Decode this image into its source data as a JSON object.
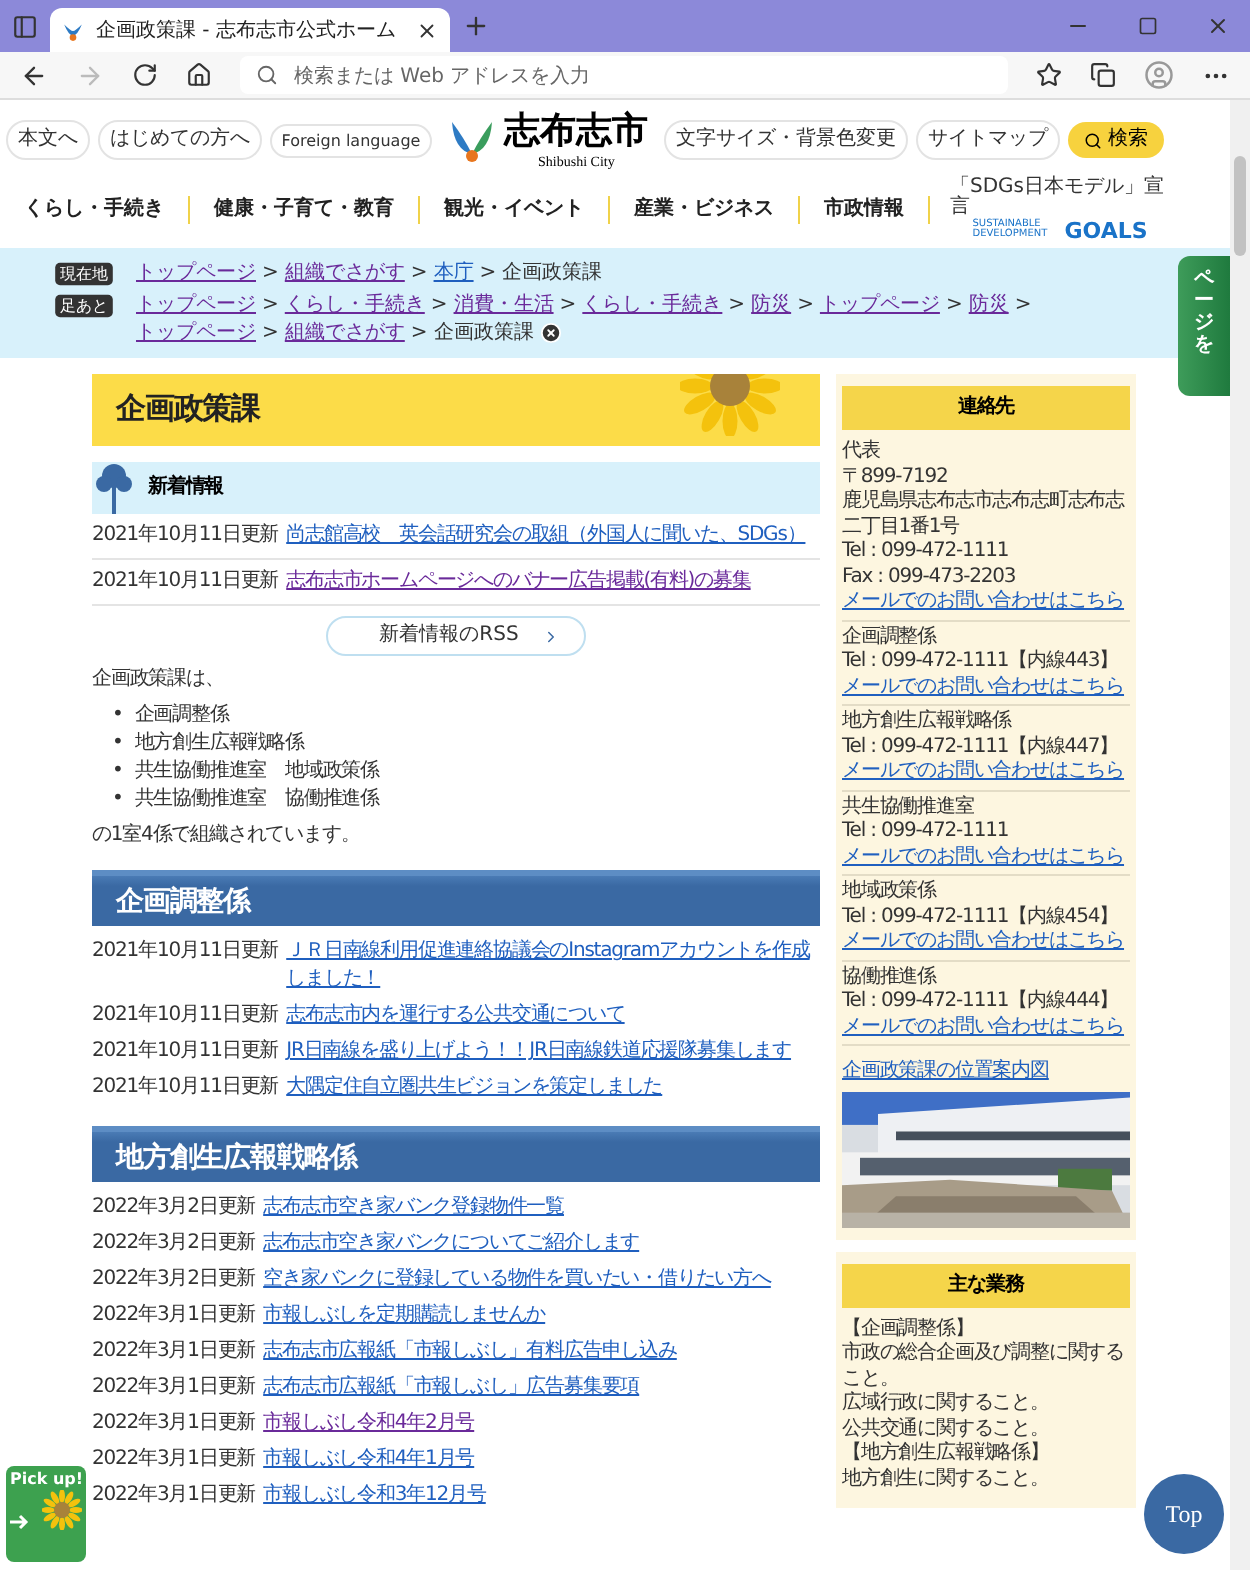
{
  "browser": {
    "tab_title": "企画政策課 - 志布志市公式ホーム",
    "address_placeholder": "検索または Web アドレスを入力"
  },
  "header": {
    "left_links": [
      "本文へ",
      "はじめての方へ",
      "Foreign language"
    ],
    "logo_title": "志布志市",
    "logo_subtitle": "Shibushi City",
    "right_links": [
      "文字サイズ・背景色変更",
      "サイトマップ"
    ],
    "search_button": "検索",
    "nav": [
      "くらし・手続き",
      "健康・子育て・教育",
      "観光・イベント",
      "産業・ビジネス",
      "市政情報"
    ],
    "sdgs": {
      "caption": "「SDGs日本モデル」宣言",
      "line1": "SUSTAINABLE DEVELOPMENT",
      "line2": "GOALS"
    }
  },
  "breadcrumb_separator": ">",
  "breadcrumbs": [
    {
      "badge": "現在地",
      "closable": false,
      "items": [
        {
          "label": "トップページ",
          "kind": "link",
          "visited": true
        },
        {
          "label": "組織でさがす",
          "kind": "link",
          "visited": true
        },
        {
          "label": "本庁",
          "kind": "link",
          "visited": false
        },
        {
          "label": "企画政策課",
          "kind": "current",
          "visited": false
        }
      ]
    },
    {
      "badge": "足あと",
      "closable": true,
      "items": [
        {
          "label": "トップページ",
          "kind": "link",
          "visited": true
        },
        {
          "label": "くらし・手続き",
          "kind": "link",
          "visited": true
        },
        {
          "label": "消費・生活",
          "kind": "link",
          "visited": true
        },
        {
          "label": "くらし・手続き",
          "kind": "link",
          "visited": true
        },
        {
          "label": "防災",
          "kind": "link",
          "visited": true
        },
        {
          "label": "トップページ",
          "kind": "link",
          "visited": true
        },
        {
          "label": "防災",
          "kind": "link",
          "visited": true
        },
        {
          "label": "トップページ",
          "kind": "link",
          "visited": true
        },
        {
          "label": "組織でさがす",
          "kind": "link",
          "visited": true
        },
        {
          "label": "企画政策課",
          "kind": "current",
          "visited": false
        }
      ]
    }
  ],
  "side_tab": {
    "label": "ページを"
  },
  "page_title": "企画政策課",
  "whats_new": {
    "heading": "新着情報",
    "rss_button": "新着情報のRSS",
    "items": [
      {
        "date": "2021年10月11日更新",
        "title": "尚志館高校　英会話研究会の取組（外国人に聞いた、SDGs）",
        "visited": false
      },
      {
        "date": "2021年10月11日更新",
        "title": "志布志市ホームページへのバナー広告掲載(有料)の募集",
        "visited": true
      }
    ]
  },
  "intro": {
    "bullet": "•",
    "lead": "企画政策課は、",
    "items": [
      "企画調整係",
      "地方創生広報戦略係",
      "共生協働推進室　地域政策係",
      "共生協働推進室　協働推進係"
    ],
    "closing": "の1室4係で組織されています。"
  },
  "sections": [
    {
      "heading": "企画調整係",
      "items": [
        {
          "date": "2021年10月11日更新",
          "title": "ＪＲ日南線利用促進連絡協議会のInstagramアカウントを作成しました！",
          "visited": false
        },
        {
          "date": "2021年10月11日更新",
          "title": "志布志市内を運行する公共交通について",
          "visited": false
        },
        {
          "date": "2021年10月11日更新",
          "title": "JR日南線を盛り上げよう！！JR日南線鉄道応援隊募集します",
          "visited": false
        },
        {
          "date": "2021年10月11日更新",
          "title": "大隅定住自立圏共生ビジョンを策定しました",
          "visited": false
        }
      ]
    },
    {
      "heading": "地方創生広報戦略係",
      "items": [
        {
          "date": "2022年3月2日更新",
          "title": "志布志市空き家バンク登録物件一覧",
          "visited": false
        },
        {
          "date": "2022年3月2日更新",
          "title": "志布志市空き家バンクについてご紹介します",
          "visited": false
        },
        {
          "date": "2022年3月2日更新",
          "title": "空き家バンクに登録している物件を買いたい・借りたい方へ",
          "visited": false
        },
        {
          "date": "2022年3月1日更新",
          "title": "市報しぶしを定期購読しませんか",
          "visited": false
        },
        {
          "date": "2022年3月1日更新",
          "title": "志布志市広報紙「市報しぶし」有料広告申し込み",
          "visited": false
        },
        {
          "date": "2022年3月1日更新",
          "title": "志布志市広報紙「市報しぶし」広告募集要項",
          "visited": false
        },
        {
          "date": "2022年3月1日更新",
          "title": "市報しぶし令和4年2月号",
          "visited": true
        },
        {
          "date": "2022年3月1日更新",
          "title": "市報しぶし令和4年1月号",
          "visited": false
        },
        {
          "date": "2022年3月1日更新",
          "title": "市報しぶし令和3年12月号",
          "visited": false
        }
      ]
    }
  ],
  "sidebar": {
    "contact": {
      "heading": "連絡先",
      "blocks": [
        {
          "lines": [
            "代表",
            "〒899-7192",
            "鹿児島県志布志市志布志町志布志二丁目1番1号",
            "Tel : 099-472-1111",
            "Fax : 099-473-2203"
          ],
          "mail_link": "メールでのお問い合わせはこちら"
        },
        {
          "lines": [
            "企画調整係",
            "Tel : 099-472-1111【内線443】"
          ],
          "mail_link": "メールでのお問い合わせはこちら"
        },
        {
          "lines": [
            "地方創生広報戦略係",
            "Tel : 099-472-1111【内線447】"
          ],
          "mail_link": "メールでのお問い合わせはこちら"
        },
        {
          "lines": [
            "共生協働推進室",
            "Tel : 099-472-1111"
          ],
          "mail_link": "メールでのお問い合わせはこちら"
        },
        {
          "lines": [
            "地域政策係",
            "Tel : 099-472-1111【内線454】"
          ],
          "mail_link": "メールでのお問い合わせはこちら"
        },
        {
          "lines": [
            "協働推進係",
            "Tel : 099-472-1111【内線444】"
          ],
          "mail_link": "メールでのお問い合わせはこちら"
        }
      ],
      "location_link": "企画政策課の位置案内図"
    },
    "duties": {
      "heading": "主な業務",
      "lines": [
        "【企画調整係】",
        "市政の総合企画及び調整に関すること。",
        "広域行政に関すること。",
        "公共交通に関すること。",
        "【地方創生広報戦略係】",
        "地方創生に関すること。"
      ]
    }
  },
  "pickup_badge": "Pick up!",
  "top_button": "Top"
}
